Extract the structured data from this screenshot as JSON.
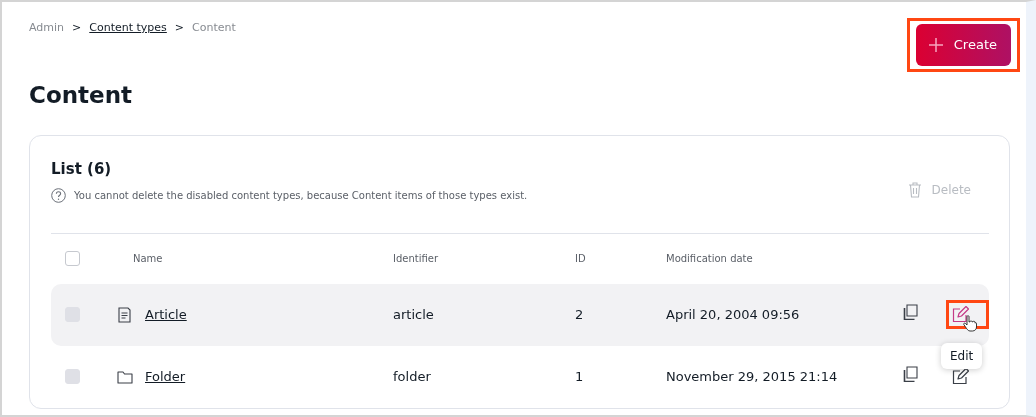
{
  "breadcrumb": [
    {
      "label": "Admin",
      "link": false
    },
    {
      "label": "Content types",
      "link": true
    },
    {
      "label": "Content",
      "link": false
    }
  ],
  "breadcrumb_separator": ">",
  "create_button": {
    "label": "Create",
    "highlighted": true
  },
  "title": "Content",
  "list": {
    "title": "List (6)",
    "info": "You cannot delete the disabled content types, because Content items of those types exist.",
    "delete_button": {
      "label": "Delete",
      "disabled": true
    },
    "columns": [
      {
        "label": "Name"
      },
      {
        "label": "Identifier"
      },
      {
        "label": "ID"
      },
      {
        "label": "Modification date"
      }
    ],
    "header_checked": false,
    "rows": [
      {
        "kind": "article",
        "name": "Article",
        "identifier": "article",
        "id": "2",
        "date": "April 20, 2004 09:56",
        "checkbox_disabled": true,
        "hovered": true,
        "edit_highlighted": true,
        "tooltip": "Edit"
      },
      {
        "kind": "folder",
        "name": "Folder",
        "identifier": "folder",
        "id": "1",
        "date": "November 29, 2015 21:14",
        "checkbox_disabled": true,
        "hovered": false,
        "edit_highlighted": false
      }
    ]
  }
}
